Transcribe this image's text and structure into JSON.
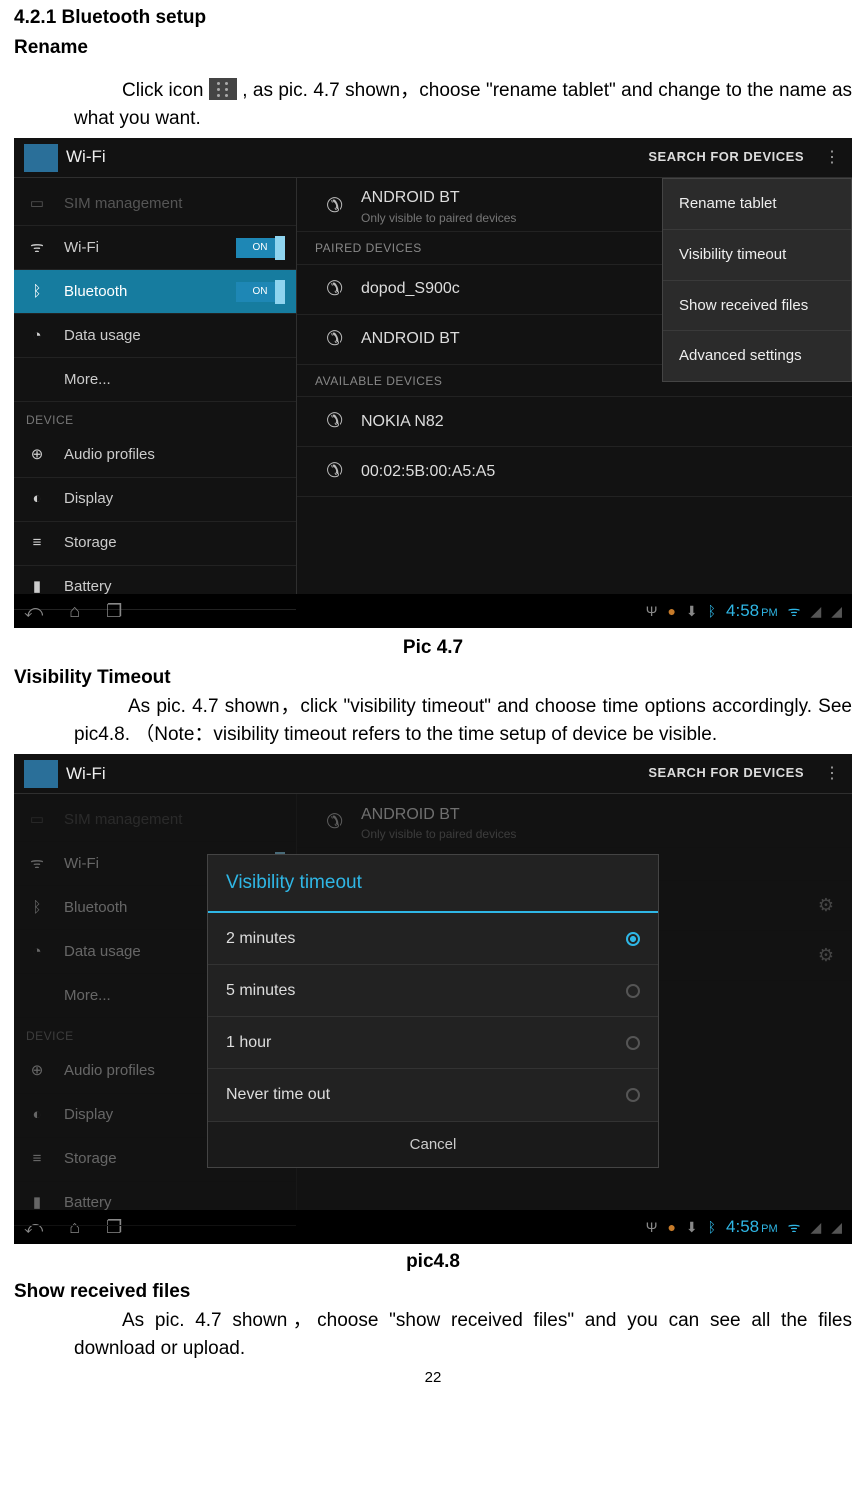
{
  "doc": {
    "heading1": "4.2.1 Bluetooth setup",
    "heading2": "Rename",
    "para1a": "Click  icon  ",
    "para1b": ",  as  pic.  4.7  shown，choose  \"rename  tablet\"  and change to the name as what you want.",
    "caption1": "Pic 4.7",
    "heading3": "Visibility Timeout",
    "para2": "As pic. 4.7 shown，click \"visibility timeout\" and choose time options accordingly.  See  pic4.8. （Note：visibility  timeout  refers  to  the  time setup of device be visible.",
    "caption2": "pic4.8",
    "heading4": "Show received files",
    "para3": "As pic. 4.7 shown，choose \"show received files\" and you can see all the files download or upload.",
    "page": "22"
  },
  "ss1": {
    "header": {
      "title": "Wi-Fi",
      "search": "SEARCH FOR DEVICES"
    },
    "left": {
      "items": [
        {
          "icon": "sim",
          "label": "SIM management",
          "dim": true
        },
        {
          "icon": "wifi",
          "label": "Wi-Fi",
          "toggle": "ON"
        },
        {
          "icon": "bt",
          "label": "Bluetooth",
          "toggle": "ON",
          "selected": true
        },
        {
          "icon": "data",
          "label": "Data usage"
        },
        {
          "icon": "",
          "label": "More..."
        }
      ],
      "cat": "DEVICE",
      "items2": [
        {
          "icon": "audio",
          "label": "Audio profiles"
        },
        {
          "icon": "display",
          "label": "Display"
        },
        {
          "icon": "storage",
          "label": "Storage"
        },
        {
          "icon": "battery",
          "label": "Battery"
        }
      ]
    },
    "right": {
      "row1": {
        "name": "ANDROID BT",
        "sub": "Only visible to paired devices"
      },
      "cat1": "PAIRED DEVICES",
      "paired": [
        {
          "name": "dopod_S900c"
        },
        {
          "name": "ANDROID BT"
        }
      ],
      "cat2": "AVAILABLE DEVICES",
      "avail": [
        {
          "name": "NOKIA N82"
        },
        {
          "name": "00:02:5B:00:A5:A5"
        }
      ]
    },
    "dropdown": [
      "Rename tablet",
      "Visibility timeout",
      "Show received files",
      "Advanced settings"
    ],
    "nav": {
      "clock": "4:58",
      "ampm": "PM"
    }
  },
  "ss2": {
    "header": {
      "title": "Wi-Fi",
      "search": "SEARCH FOR DEVICES"
    },
    "dialog": {
      "title": "Visibility timeout",
      "options": [
        {
          "label": "2 minutes",
          "sel": true
        },
        {
          "label": "5 minutes",
          "sel": false
        },
        {
          "label": "1 hour",
          "sel": false
        },
        {
          "label": "Never time out",
          "sel": false
        }
      ],
      "cancel": "Cancel"
    },
    "nav": {
      "clock": "4:58",
      "ampm": "PM"
    }
  }
}
